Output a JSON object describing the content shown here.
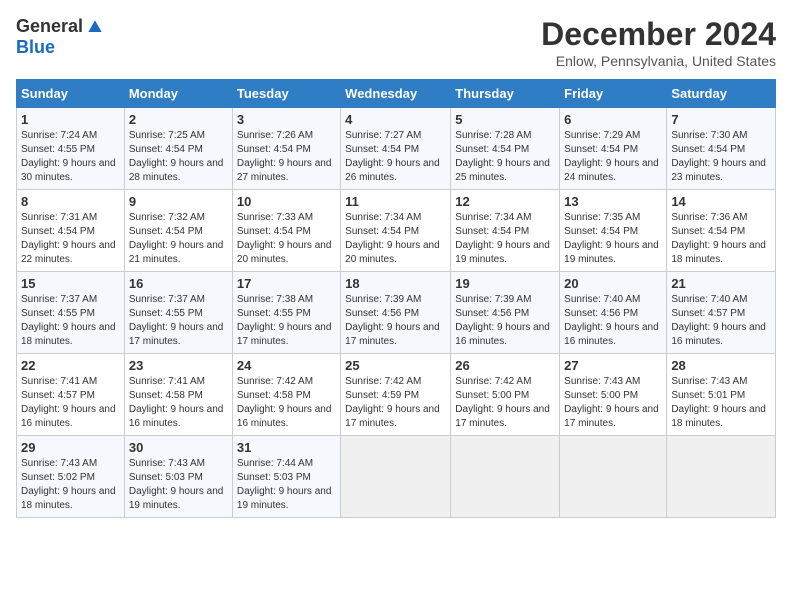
{
  "logo": {
    "general": "General",
    "blue": "Blue"
  },
  "title": "December 2024",
  "location": "Enlow, Pennsylvania, United States",
  "days_of_week": [
    "Sunday",
    "Monday",
    "Tuesday",
    "Wednesday",
    "Thursday",
    "Friday",
    "Saturday"
  ],
  "weeks": [
    [
      {
        "day": "1",
        "sunrise": "7:24 AM",
        "sunset": "4:55 PM",
        "daylight": "9 hours and 30 minutes."
      },
      {
        "day": "2",
        "sunrise": "7:25 AM",
        "sunset": "4:54 PM",
        "daylight": "9 hours and 28 minutes."
      },
      {
        "day": "3",
        "sunrise": "7:26 AM",
        "sunset": "4:54 PM",
        "daylight": "9 hours and 27 minutes."
      },
      {
        "day": "4",
        "sunrise": "7:27 AM",
        "sunset": "4:54 PM",
        "daylight": "9 hours and 26 minutes."
      },
      {
        "day": "5",
        "sunrise": "7:28 AM",
        "sunset": "4:54 PM",
        "daylight": "9 hours and 25 minutes."
      },
      {
        "day": "6",
        "sunrise": "7:29 AM",
        "sunset": "4:54 PM",
        "daylight": "9 hours and 24 minutes."
      },
      {
        "day": "7",
        "sunrise": "7:30 AM",
        "sunset": "4:54 PM",
        "daylight": "9 hours and 23 minutes."
      }
    ],
    [
      {
        "day": "8",
        "sunrise": "7:31 AM",
        "sunset": "4:54 PM",
        "daylight": "9 hours and 22 minutes."
      },
      {
        "day": "9",
        "sunrise": "7:32 AM",
        "sunset": "4:54 PM",
        "daylight": "9 hours and 21 minutes."
      },
      {
        "day": "10",
        "sunrise": "7:33 AM",
        "sunset": "4:54 PM",
        "daylight": "9 hours and 20 minutes."
      },
      {
        "day": "11",
        "sunrise": "7:34 AM",
        "sunset": "4:54 PM",
        "daylight": "9 hours and 20 minutes."
      },
      {
        "day": "12",
        "sunrise": "7:34 AM",
        "sunset": "4:54 PM",
        "daylight": "9 hours and 19 minutes."
      },
      {
        "day": "13",
        "sunrise": "7:35 AM",
        "sunset": "4:54 PM",
        "daylight": "9 hours and 19 minutes."
      },
      {
        "day": "14",
        "sunrise": "7:36 AM",
        "sunset": "4:54 PM",
        "daylight": "9 hours and 18 minutes."
      }
    ],
    [
      {
        "day": "15",
        "sunrise": "7:37 AM",
        "sunset": "4:55 PM",
        "daylight": "9 hours and 18 minutes."
      },
      {
        "day": "16",
        "sunrise": "7:37 AM",
        "sunset": "4:55 PM",
        "daylight": "9 hours and 17 minutes."
      },
      {
        "day": "17",
        "sunrise": "7:38 AM",
        "sunset": "4:55 PM",
        "daylight": "9 hours and 17 minutes."
      },
      {
        "day": "18",
        "sunrise": "7:39 AM",
        "sunset": "4:56 PM",
        "daylight": "9 hours and 17 minutes."
      },
      {
        "day": "19",
        "sunrise": "7:39 AM",
        "sunset": "4:56 PM",
        "daylight": "9 hours and 16 minutes."
      },
      {
        "day": "20",
        "sunrise": "7:40 AM",
        "sunset": "4:56 PM",
        "daylight": "9 hours and 16 minutes."
      },
      {
        "day": "21",
        "sunrise": "7:40 AM",
        "sunset": "4:57 PM",
        "daylight": "9 hours and 16 minutes."
      }
    ],
    [
      {
        "day": "22",
        "sunrise": "7:41 AM",
        "sunset": "4:57 PM",
        "daylight": "9 hours and 16 minutes."
      },
      {
        "day": "23",
        "sunrise": "7:41 AM",
        "sunset": "4:58 PM",
        "daylight": "9 hours and 16 minutes."
      },
      {
        "day": "24",
        "sunrise": "7:42 AM",
        "sunset": "4:58 PM",
        "daylight": "9 hours and 16 minutes."
      },
      {
        "day": "25",
        "sunrise": "7:42 AM",
        "sunset": "4:59 PM",
        "daylight": "9 hours and 17 minutes."
      },
      {
        "day": "26",
        "sunrise": "7:42 AM",
        "sunset": "5:00 PM",
        "daylight": "9 hours and 17 minutes."
      },
      {
        "day": "27",
        "sunrise": "7:43 AM",
        "sunset": "5:00 PM",
        "daylight": "9 hours and 17 minutes."
      },
      {
        "day": "28",
        "sunrise": "7:43 AM",
        "sunset": "5:01 PM",
        "daylight": "9 hours and 18 minutes."
      }
    ],
    [
      {
        "day": "29",
        "sunrise": "7:43 AM",
        "sunset": "5:02 PM",
        "daylight": "9 hours and 18 minutes."
      },
      {
        "day": "30",
        "sunrise": "7:43 AM",
        "sunset": "5:03 PM",
        "daylight": "9 hours and 19 minutes."
      },
      {
        "day": "31",
        "sunrise": "7:44 AM",
        "sunset": "5:03 PM",
        "daylight": "9 hours and 19 minutes."
      },
      null,
      null,
      null,
      null
    ]
  ],
  "labels": {
    "sunrise": "Sunrise:",
    "sunset": "Sunset:",
    "daylight": "Daylight:"
  }
}
